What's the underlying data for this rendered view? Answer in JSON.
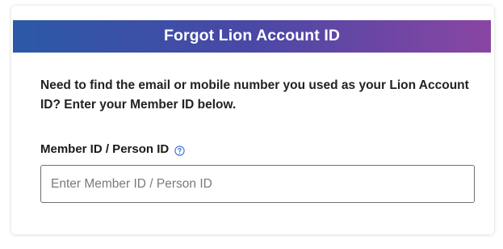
{
  "header": {
    "title": "Forgot Lion Account ID"
  },
  "intro": {
    "text": "Need to find the email or mobile number you used as your Lion Account ID? Enter your Member ID below."
  },
  "member_field": {
    "label": "Member ID / Person ID",
    "help_icon": "question-circle-icon",
    "placeholder": "Enter Member ID / Person ID",
    "value": ""
  },
  "colors": {
    "gradient_start": "#2b59a8",
    "gradient_end": "#8a45a3",
    "help_icon": "#2f6fd1"
  }
}
